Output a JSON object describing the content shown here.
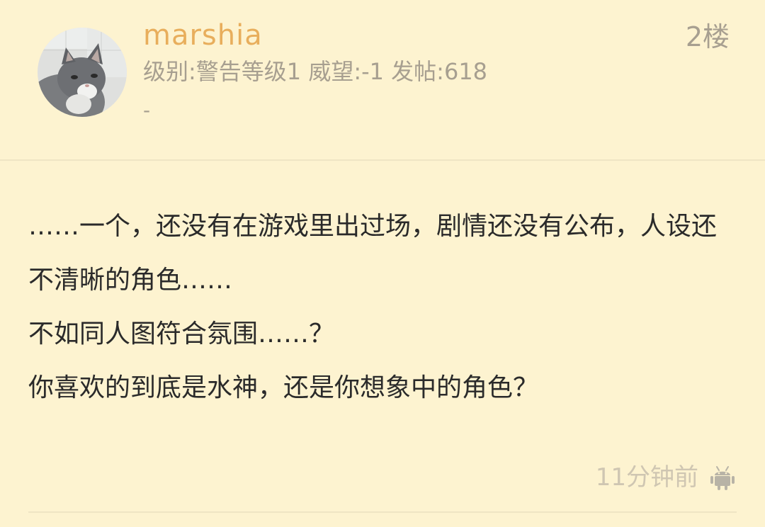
{
  "post": {
    "user": {
      "name": "marshia",
      "meta": "级别:警告等级1 威望:-1 发帖:618",
      "signature": "-"
    },
    "floor_label": "2楼",
    "content": {
      "paragraphs": [
        "……一个，还没有在游戏里出过场，剧情还没有公布，人设还不清晰的角色……",
        "不如同人图符合氛围……？",
        "你喜欢的到底是水神，还是你想象中的角色？"
      ]
    },
    "footer": {
      "time": "11分钟前",
      "device_icon": "android-icon"
    }
  },
  "colors": {
    "background": "#fdf3d0",
    "username": "#e8ae5c",
    "meta": "#a79f90",
    "content": "#2a2a2a",
    "time": "#cfc6b2",
    "divider": "#efe5c4"
  }
}
